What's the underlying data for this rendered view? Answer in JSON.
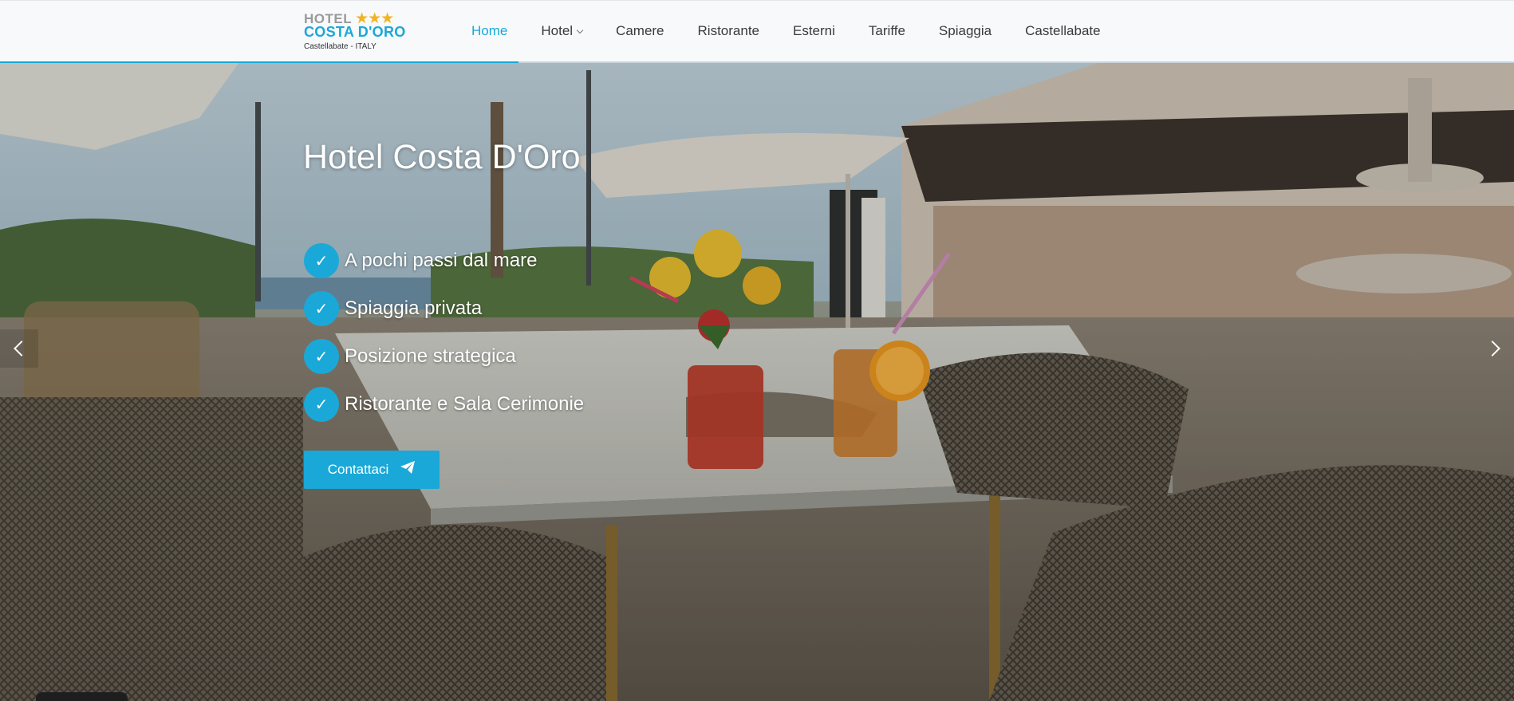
{
  "header": {
    "logo": {
      "line1": "HOTEL",
      "stars": "★★★",
      "line2": "COSTA D'ORO",
      "line3": "Castellabate - ITALY"
    },
    "nav": [
      {
        "label": "Home",
        "active": true
      },
      {
        "label": "Hotel",
        "has_dropdown": true
      },
      {
        "label": "Camere"
      },
      {
        "label": "Ristorante"
      },
      {
        "label": "Esterni"
      },
      {
        "label": "Tariffe"
      },
      {
        "label": "Spiaggia"
      },
      {
        "label": "Castellabate"
      }
    ]
  },
  "hero": {
    "title": "Hotel Costa D'Oro",
    "features": [
      "A pochi passi dal mare",
      "Spiaggia privata",
      "Posizione strategica",
      "Ristorante e Sala Cerimonie"
    ],
    "cta_label": "Contattaci",
    "cta_icon": "paper-plane-icon",
    "check_icon": "check-icon"
  },
  "colors": {
    "accent": "#1aa8d8",
    "stars": "#f0b323",
    "header_bg": "#f7f9fb",
    "nav_text": "#3a3a3a"
  }
}
